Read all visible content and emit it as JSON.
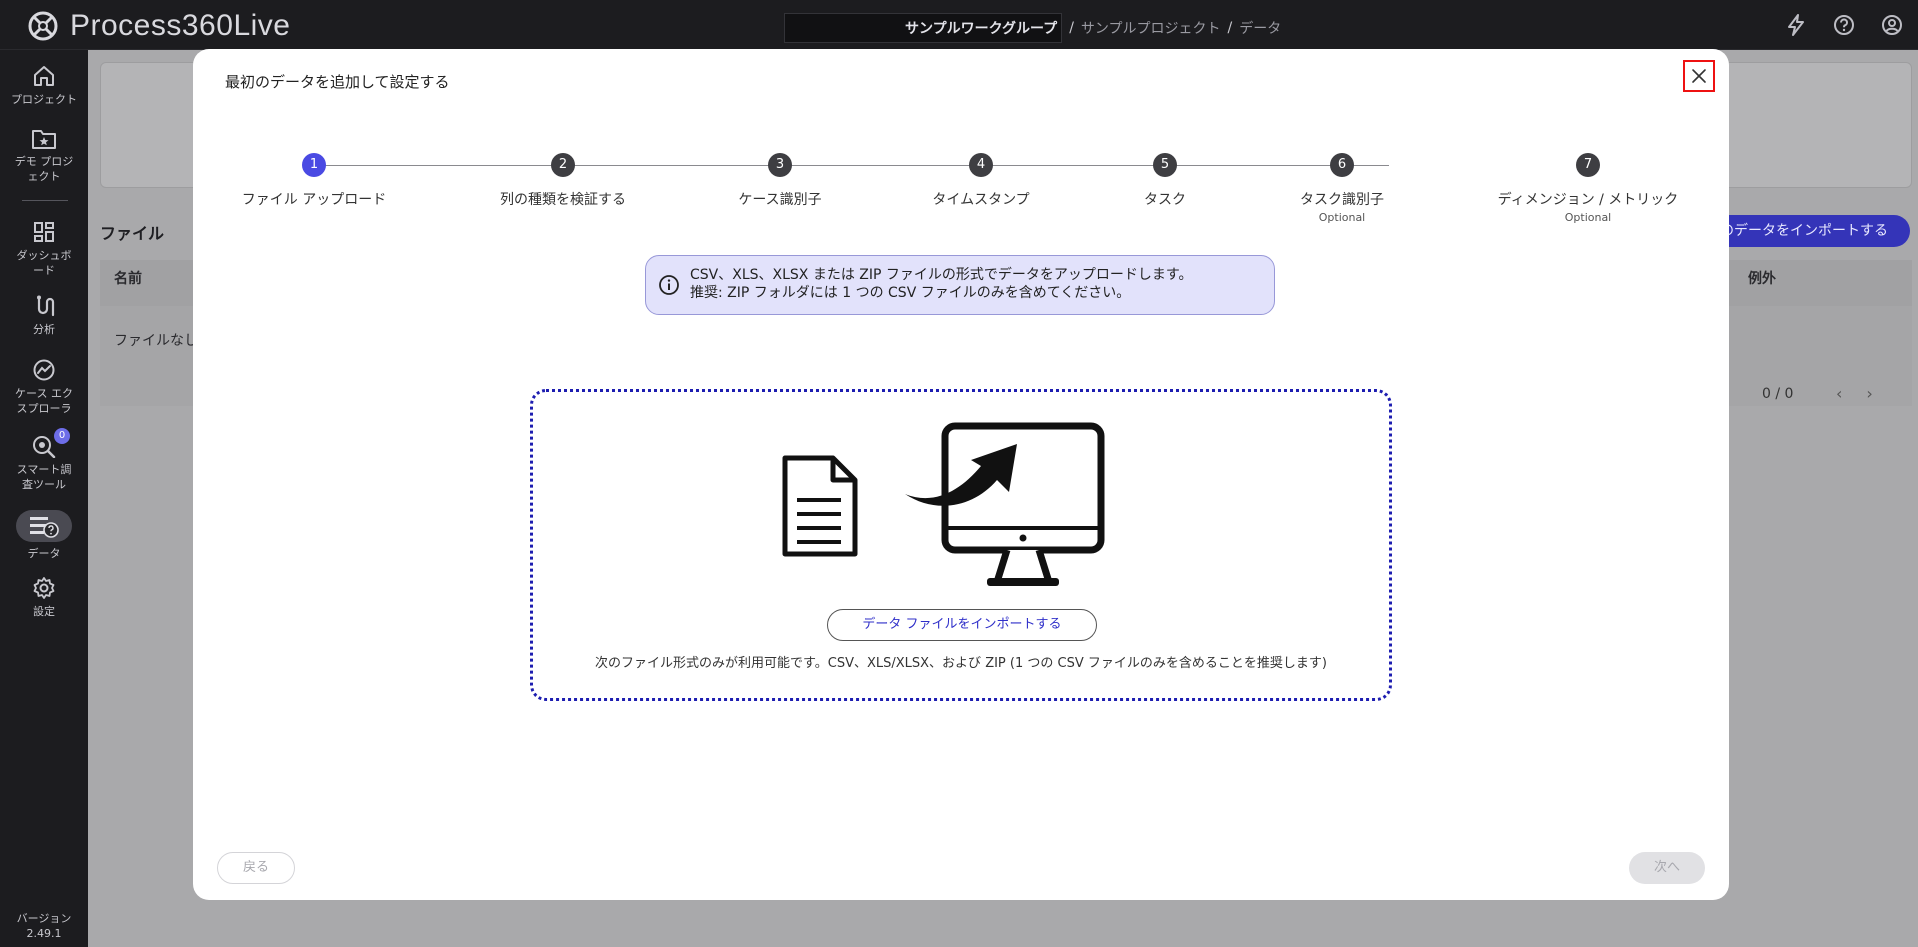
{
  "app": {
    "logo_text_main": "Process360",
    "logo_text_sub": "Live"
  },
  "breadcrumb": {
    "workgroup": "サンプルワークグループ",
    "separator": "/",
    "project": "サンプルプロジェクト",
    "page": "データ"
  },
  "sidebar": {
    "items": [
      {
        "label": "プロジェクト",
        "icon": "home-icon"
      },
      {
        "label": "デモ プロジェクト",
        "icon": "star-folder-icon"
      },
      {
        "label": "ダッシュボード",
        "icon": "dashboard-icon"
      },
      {
        "label": "分析",
        "icon": "analysis-icon"
      },
      {
        "label": "ケース エクスプローラ",
        "icon": "case-explorer-icon"
      },
      {
        "label": "スマート調査ツール",
        "icon": "smart-investigation-icon",
        "badge": "0"
      },
      {
        "label": "データ",
        "icon": "data-icon"
      },
      {
        "label": "設定",
        "icon": "gear-icon"
      }
    ],
    "version_label": "バージョン",
    "version_number": "2.49.1"
  },
  "background": {
    "files_title": "ファイル",
    "import_button": "のデータをインポートする",
    "col_name": "名前",
    "col_exception": "例外",
    "no_files": "ファイルなし",
    "pager": "0 / 0"
  },
  "modal": {
    "title": "最初のデータを追加して設定する",
    "steps": [
      {
        "number": "1",
        "label": "ファイル アップロード",
        "optional": ""
      },
      {
        "number": "2",
        "label": "列の種類を検証する",
        "optional": ""
      },
      {
        "number": "3",
        "label": "ケース識別子",
        "optional": ""
      },
      {
        "number": "4",
        "label": "タイムスタンプ",
        "optional": ""
      },
      {
        "number": "5",
        "label": "タスク",
        "optional": ""
      },
      {
        "number": "6",
        "label": "タスク識別子",
        "optional": "Optional"
      },
      {
        "number": "7",
        "label": "ディメンジョン / メトリック",
        "optional": "Optional"
      }
    ],
    "info_line1": "CSV、XLS、XLSX または ZIP ファイルの形式でデータをアップロードします。",
    "info_line2": "推奨: ZIP フォルダには 1 つの CSV ファイルのみを含めてください。",
    "import_button": "データ ファイルをインポートする",
    "formats_text": "次のファイル形式のみが利用可能です。CSV、XLS/XLSX、および ZIP (1 つの CSV ファイルのみを含めることを推奨します)",
    "back_button": "戻る",
    "next_button": "次へ"
  },
  "colors": {
    "accent": "#4a4ae3",
    "dropzone_border": "#1d1db0",
    "info_bg": "#e2e2fb",
    "close_highlight": "#ee1111"
  }
}
